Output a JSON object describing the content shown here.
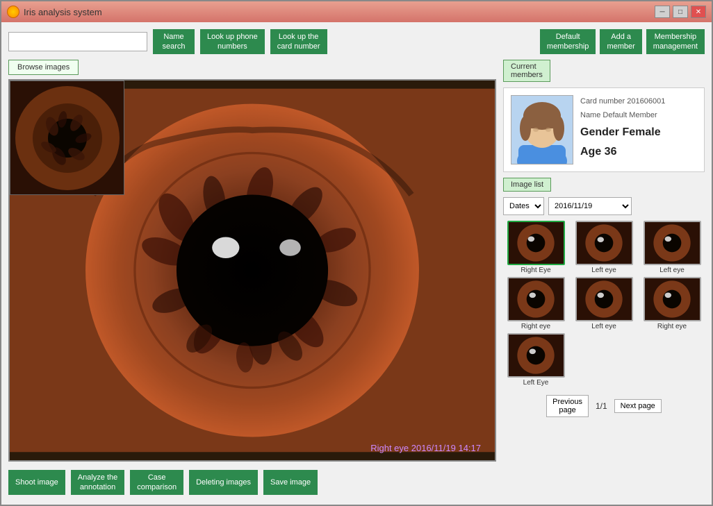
{
  "window": {
    "title": "Iris analysis system",
    "icon": "eye-icon"
  },
  "topbar": {
    "search_placeholder": "",
    "buttons": [
      {
        "label": "Name\nsearch",
        "id": "name-search"
      },
      {
        "label": "Look up phone\nnumbers",
        "id": "lookup-phone"
      },
      {
        "label": "Look up the\ncard number",
        "id": "lookup-card"
      }
    ],
    "right_buttons": [
      {
        "label": "Default\nmembership",
        "id": "default-membership"
      },
      {
        "label": "Add a\nmember",
        "id": "add-member"
      },
      {
        "label": "Membership\nmanagement",
        "id": "membership-mgmt"
      }
    ]
  },
  "left": {
    "browse_images_label": "Browse images",
    "image_timestamp": "Right eye  2016/11/19 14:17"
  },
  "member": {
    "section_label": "Current\nmembers",
    "card_number_label": "Card number 201606001",
    "name_label": "Name Default Member",
    "gender_label": "Gender Female",
    "age_label": "Age 36"
  },
  "image_list": {
    "section_label": "Image list",
    "date_filter_option": "Dates",
    "date_option": "2016/11/19",
    "thumbnails": [
      {
        "label": "Right Eye",
        "selected": true
      },
      {
        "label": "Left eye",
        "selected": false
      },
      {
        "label": "Left eye",
        "selected": false
      },
      {
        "label": "Right eye",
        "selected": false
      },
      {
        "label": "Left eye",
        "selected": false
      },
      {
        "label": "Right eye",
        "selected": false
      },
      {
        "label": "Left Eye",
        "selected": false
      }
    ],
    "pagination": {
      "prev_label": "Previous\npage",
      "next_label": "Next page",
      "page_info": "1/1"
    }
  },
  "bottom_buttons": [
    {
      "label": "Shoot image",
      "id": "shoot-image"
    },
    {
      "label": "Analyze the\nannotation",
      "id": "analyze-annotation"
    },
    {
      "label": "Case\ncomparison",
      "id": "case-comparison"
    },
    {
      "label": "Deleting images",
      "id": "delete-images"
    },
    {
      "label": "Save image",
      "id": "save-image"
    }
  ]
}
